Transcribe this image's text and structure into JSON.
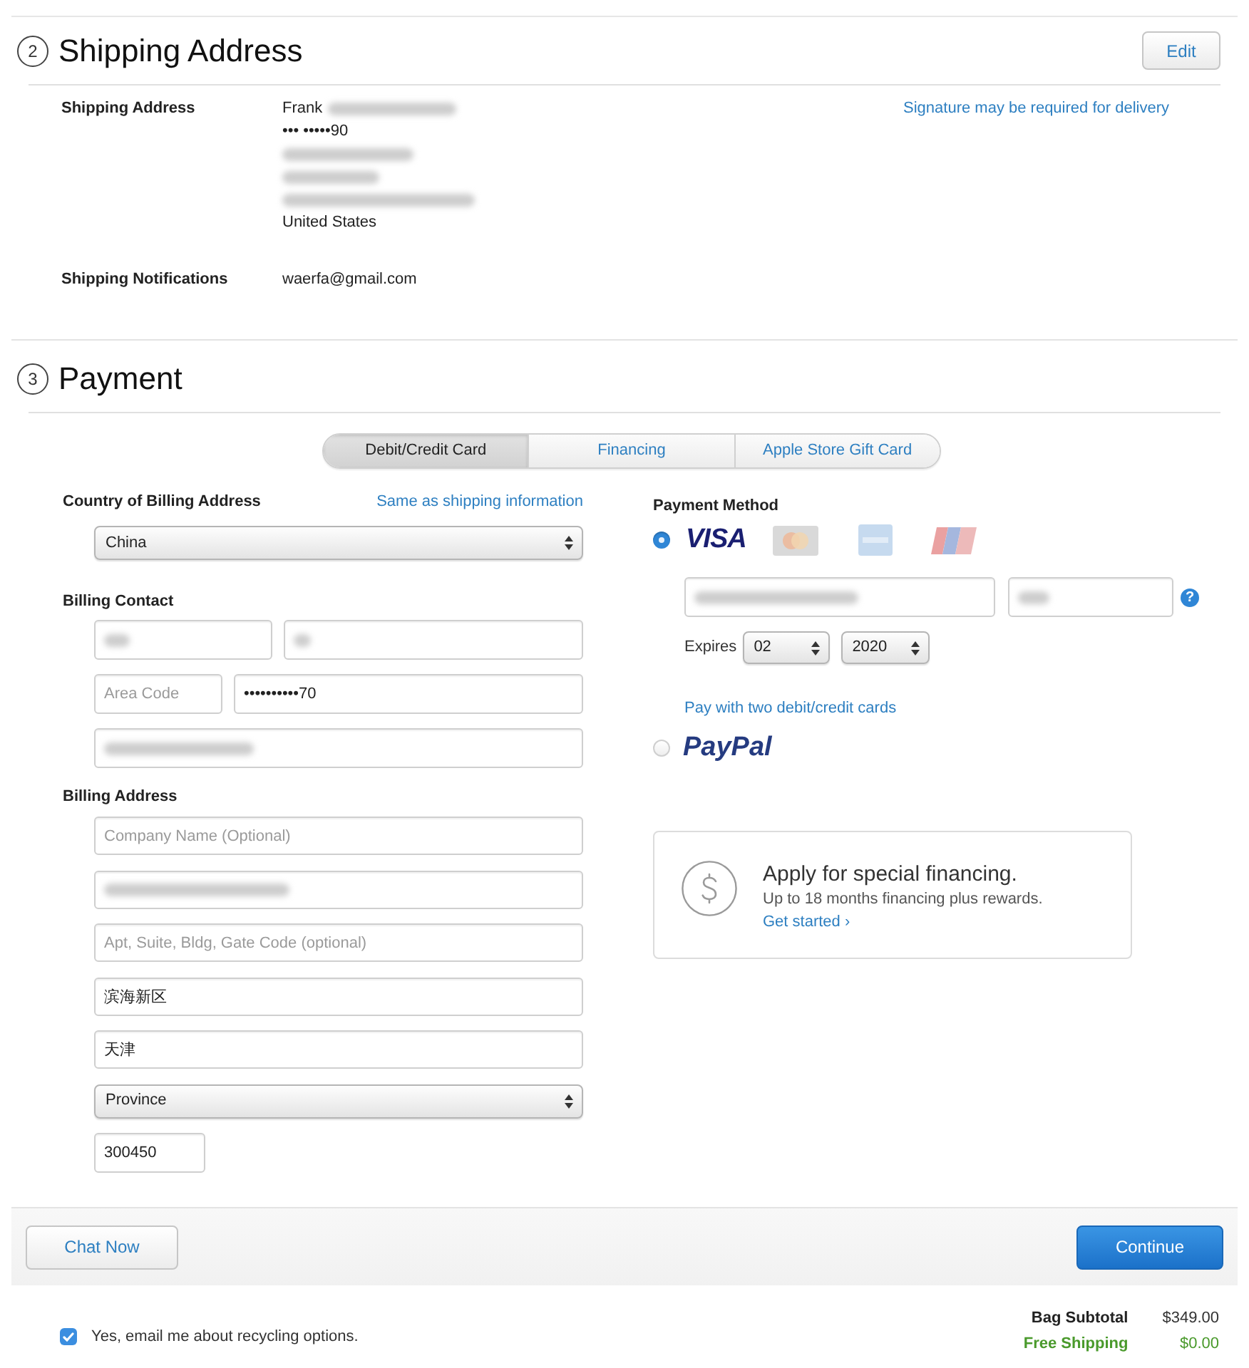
{
  "shipping": {
    "step": "2",
    "title": "Shipping Address",
    "edit_button": "Edit",
    "rows": [
      {
        "label": "Shipping Address",
        "lines": [
          {
            "text": "Frank",
            "blurred": true
          },
          {
            "text": "••• •••••90",
            "blurred": false
          },
          {
            "blurred": true
          },
          {
            "blurred": true
          },
          {
            "blurred": true
          },
          {
            "text": "United States",
            "blurred": false
          }
        ],
        "note": "Signature may be required for delivery"
      },
      {
        "label": "Shipping Notifications",
        "lines": [
          {
            "text": "waerfa@gmail.com",
            "blurred": false
          }
        ]
      }
    ]
  },
  "payment": {
    "step": "3",
    "title": "Payment",
    "tabs": [
      {
        "label": "Debit/Credit Card",
        "selected": true
      },
      {
        "label": "Financing",
        "selected": false
      },
      {
        "label": "Apple Store Gift Card",
        "selected": false
      }
    ],
    "billing": {
      "country": {
        "label": "Country of Billing Address",
        "link": "Same as shipping information",
        "select": {
          "value": "China"
        }
      },
      "contact": {
        "label": "Billing Contact",
        "rows": [
          [
            {
              "blurred": true
            },
            {
              "blurred": true
            }
          ],
          [
            {
              "placeholder": "Area Code",
              "blurred": false
            },
            {
              "value": "••••••••••70",
              "blurred": false
            }
          ],
          [
            {
              "blurred": true
            }
          ]
        ]
      },
      "address": {
        "label": "Billing Address",
        "fields": [
          {
            "kind": "input",
            "placeholder": "Company Name (Optional)",
            "blurred": false
          },
          {
            "kind": "input",
            "blurred": true
          },
          {
            "kind": "input",
            "placeholder": "Apt, Suite, Bldg, Gate Code (optional)",
            "blurred": false
          },
          {
            "kind": "input",
            "value": "滨海新区",
            "blurred": false
          },
          {
            "kind": "input",
            "value": "天津",
            "blurred": false
          },
          {
            "kind": "select",
            "value": "Province",
            "blurred": false
          },
          {
            "kind": "postal",
            "value": "300450",
            "blurred": false
          }
        ]
      }
    },
    "payment_method": {
      "label": "Payment Method",
      "options": [
        {
          "kind": "card",
          "selected": true,
          "logo": "VISA",
          "card_fields": [
            {
              "blurred": true
            },
            {
              "blurred": true
            }
          ],
          "help": "?",
          "expires": {
            "label": "Expires",
            "month": "02",
            "year": "2020"
          },
          "link": "Pay with two debit/credit cards"
        },
        {
          "kind": "paypal",
          "selected": false,
          "logo": "PayPal"
        }
      ]
    },
    "financing_offer": {
      "title": "Apply for special financing.",
      "text": "Up to 18 months financing plus rewards.",
      "link": "Get started ›"
    }
  },
  "footer": {
    "chat_button": "Chat Now",
    "continue_button": "Continue",
    "recycling_opt_in": {
      "label": "Yes, email me about recycling options.",
      "checked": true
    },
    "totals": [
      {
        "kind": "subtotal",
        "label": "Bag Subtotal",
        "value": "$349.00"
      },
      {
        "kind": "shipping",
        "label": "Free Shipping",
        "value": "$0.00"
      }
    ]
  }
}
